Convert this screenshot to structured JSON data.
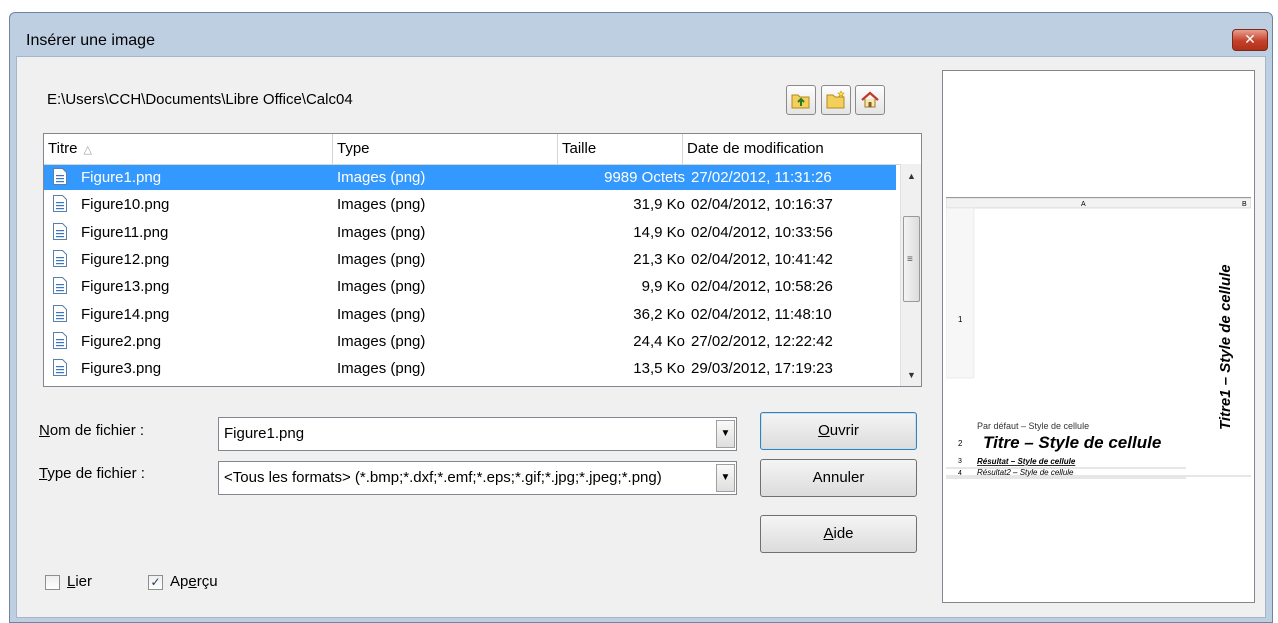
{
  "window": {
    "title": "Insérer une image",
    "close_symbol": "✕"
  },
  "path": "E:\\Users\\CCH\\Documents\\Libre Office\\Calc04",
  "toolbar": {
    "icons": [
      "folder-up-icon",
      "new-folder-icon",
      "home-icon"
    ]
  },
  "file_list": {
    "columns": {
      "title": "Titre",
      "type": "Type",
      "size": "Taille",
      "date": "Date de modification"
    },
    "sort_indicator": "△",
    "rows": [
      {
        "name": "Figure1.png",
        "type": "Images (png)",
        "size": "9989 Octets",
        "date": "27/02/2012, 11:31:26",
        "selected": true
      },
      {
        "name": "Figure10.png",
        "type": "Images (png)",
        "size": "31,9 Ko",
        "date": "02/04/2012, 10:16:37"
      },
      {
        "name": "Figure11.png",
        "type": "Images (png)",
        "size": "14,9 Ko",
        "date": "02/04/2012, 10:33:56"
      },
      {
        "name": "Figure12.png",
        "type": "Images (png)",
        "size": "21,3 Ko",
        "date": "02/04/2012, 10:41:42"
      },
      {
        "name": "Figure13.png",
        "type": "Images (png)",
        "size": "9,9 Ko",
        "date": "02/04/2012, 10:58:26"
      },
      {
        "name": "Figure14.png",
        "type": "Images (png)",
        "size": "36,2 Ko",
        "date": "02/04/2012, 11:48:10"
      },
      {
        "name": "Figure2.png",
        "type": "Images (png)",
        "size": "24,4 Ko",
        "date": "27/02/2012, 12:22:42"
      },
      {
        "name": "Figure3.png",
        "type": "Images (png)",
        "size": "13,5 Ko",
        "date": "29/03/2012, 17:19:23"
      }
    ]
  },
  "form": {
    "filename_label_first": "N",
    "filename_label_rest": "om de fichier :",
    "filename_value": "Figure1.png",
    "filetype_label_first": "T",
    "filetype_label_rest": "ype de fichier :",
    "filetype_value": "<Tous les formats> (*.bmp;*.dxf;*.emf;*.eps;*.gif;*.jpg;*.jpeg;*.png)"
  },
  "buttons": {
    "open_first": "O",
    "open_rest": "uvrir",
    "cancel": "Annuler",
    "help_first": "A",
    "help_rest": "ide"
  },
  "options": {
    "link_first": "L",
    "link_rest": "ier",
    "link_checked": false,
    "preview_first": "Ap",
    "preview_acc": "e",
    "preview_rest": "rçu",
    "preview_checked": true
  },
  "preview": {
    "col_a": "A",
    "col_b": "B",
    "row_labels": [
      "1",
      "2",
      "3",
      "4"
    ],
    "vertical_title": "Titre1 – Style de cellule",
    "default_text": "Par défaut – Style de cellule",
    "title_text": "Titre – Style de cellule",
    "result_text": "Résultat – Style de cellule",
    "result2_text": "Résultat2 – Style de cellule"
  },
  "colors": {
    "selection": "#3399ff",
    "frame": "#bfcfe2",
    "close": "#c4402a"
  }
}
